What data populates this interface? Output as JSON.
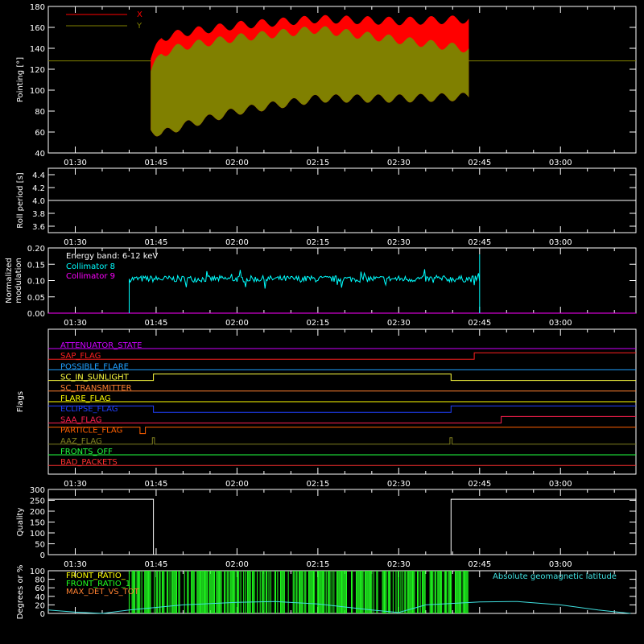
{
  "chart_data": [
    {
      "type": "line",
      "ylabel": "Pointing [°]",
      "ylim": [
        40,
        180
      ],
      "yticks": [
        40,
        60,
        80,
        100,
        120,
        140,
        160,
        180
      ],
      "xticks": [
        "01:30",
        "01:45",
        "02:00",
        "02:15",
        "02:30",
        "02:45",
        "03:00"
      ],
      "xlim_minutes": [
        85,
        194
      ],
      "legend": [
        {
          "name": "X",
          "color": "#ff0000"
        },
        {
          "name": "Y",
          "color": "#808000"
        }
      ],
      "baseline_value": 128,
      "active_start": "01:44",
      "active_end": "02:43",
      "series": [
        {
          "name": "X",
          "color": "#ff0000",
          "upper_envelope": [
            [
              104,
              130
            ],
            [
              106,
              150
            ],
            [
              110,
              155
            ],
            [
              120,
              162
            ],
            [
              135,
              168
            ],
            [
              150,
              166
            ],
            [
              165,
              168
            ],
            [
              180,
              164
            ],
            [
              193,
              162
            ]
          ],
          "lower_envelope": [
            [
              104,
              62
            ],
            [
              106,
              58
            ],
            [
              110,
              66
            ],
            [
              120,
              80
            ],
            [
              135,
              92
            ],
            [
              150,
              92
            ],
            [
              165,
              94
            ],
            [
              180,
              90
            ],
            [
              193,
              86
            ]
          ]
        },
        {
          "name": "Y",
          "color": "#808000",
          "upper_envelope": [
            [
              104,
              118
            ],
            [
              106,
              135
            ],
            [
              110,
              142
            ],
            [
              120,
              150
            ],
            [
              135,
              158
            ],
            [
              150,
              148
            ],
            [
              165,
              138
            ],
            [
              180,
              135
            ],
            [
              193,
              130
            ]
          ],
          "lower_envelope": [
            [
              104,
              62
            ],
            [
              106,
              58
            ],
            [
              110,
              66
            ],
            [
              120,
              80
            ],
            [
              135,
              92
            ],
            [
              150,
              92
            ],
            [
              165,
              94
            ],
            [
              180,
              90
            ],
            [
              193,
              86
            ]
          ]
        }
      ]
    },
    {
      "type": "line",
      "ylabel": "Roll period [s]",
      "ylim": [
        3.5,
        4.5
      ],
      "yticks": [
        3.6,
        3.8,
        4.0,
        4.2,
        4.4
      ],
      "ytick_labels": [
        "3.6",
        "3.8",
        "4.0",
        "4.2",
        "4.4"
      ],
      "xticks": [
        "01:30",
        "01:45",
        "02:00",
        "02:15",
        "02:30",
        "02:45",
        "03:00"
      ],
      "series": [
        {
          "name": "",
          "color": "#ffffff",
          "value": 4.0
        }
      ]
    },
    {
      "type": "line",
      "ylabel": "Normalized modulation",
      "ylim": [
        0,
        0.2
      ],
      "yticks": [
        0,
        0.05,
        0.1,
        0.15,
        0.2
      ],
      "ytick_labels": [
        "0.00",
        "0.05",
        "0.10",
        "0.15",
        "0.20"
      ],
      "xticks": [
        "01:30",
        "01:45",
        "02:00",
        "02:15",
        "02:30",
        "02:45",
        "03:00"
      ],
      "annotation": "Energy band: 6-12 keV",
      "legend": [
        {
          "name": "Collimator 8",
          "color": "#00ffff"
        },
        {
          "name": "Collimator 9",
          "color": "#ff00ff"
        }
      ],
      "series": [
        {
          "name": "Collimator 8",
          "color": "#00ffff",
          "start": "01:40",
          "end": "02:45",
          "mean": 0.105,
          "spread": 0.01
        },
        {
          "name": "Collimator 9",
          "color": "#ff00ff",
          "value": 0.0
        }
      ]
    },
    {
      "type": "line",
      "ylabel": "Flags",
      "xticks": [
        "01:30",
        "01:45",
        "02:00",
        "02:15",
        "02:30",
        "02:45",
        "03:00"
      ],
      "flags": [
        {
          "name": "ATTENUATOR_STATE",
          "color": "#cc00ff",
          "segments": [
            [
              85,
              194,
              0
            ]
          ]
        },
        {
          "name": "SAP_FLAG",
          "color": "#ff2020",
          "segments": [
            [
              85,
              164,
              0
            ],
            [
              164,
              194,
              1
            ]
          ]
        },
        {
          "name": "POSSIBLE_FLARE",
          "color": "#20a0ff",
          "segments": [
            [
              85,
              194,
              0
            ]
          ]
        },
        {
          "name": "SC_IN_SUNLIGHT",
          "color": "#ffff40",
          "segments": [
            [
              85,
              104.5,
              0
            ],
            [
              104.5,
              159.7,
              1
            ],
            [
              159.7,
              194,
              0
            ]
          ]
        },
        {
          "name": "SC_TRANSMITTER",
          "color": "#ff8030",
          "segments": [
            [
              85,
              194,
              0
            ]
          ]
        },
        {
          "name": "FLARE_FLAG",
          "color": "#ffff00",
          "segments": [
            [
              85,
              194,
              0
            ]
          ]
        },
        {
          "name": "ECLIPSE_FLAG",
          "color": "#2040ff",
          "segments": [
            [
              85,
              104.5,
              1
            ],
            [
              104.5,
              159.7,
              0
            ],
            [
              159.7,
              194,
              1
            ]
          ]
        },
        {
          "name": "SAA_FLAG",
          "color": "#ff2050",
          "segments": [
            [
              85,
              169,
              0
            ],
            [
              169,
              194,
              1
            ]
          ]
        },
        {
          "name": "PARTICLE_FLAG",
          "color": "#ff6000",
          "segments": [
            [
              85,
              102,
              1
            ],
            [
              102,
              103,
              0
            ],
            [
              103,
              194,
              1
            ]
          ]
        },
        {
          "name": "AAZ_FLAG",
          "color": "#808020",
          "segments": [
            [
              85,
              104.3,
              0
            ],
            [
              104.3,
              104.7,
              1
            ],
            [
              104.7,
              159.5,
              0
            ],
            [
              159.5,
              159.9,
              1
            ],
            [
              159.9,
              194,
              0
            ]
          ]
        },
        {
          "name": "FRONTS_OFF",
          "color": "#20ff40",
          "segments": [
            [
              85,
              194,
              0
            ]
          ]
        },
        {
          "name": "BAD_PACKETS",
          "color": "#ff3030",
          "segments": [
            [
              85,
              194,
              0
            ]
          ]
        }
      ]
    },
    {
      "type": "line",
      "ylabel": "Quality",
      "ylim": [
        0,
        300
      ],
      "yticks": [
        0,
        50,
        100,
        150,
        200,
        250,
        300
      ],
      "xticks": [
        "01:30",
        "01:45",
        "02:00",
        "02:15",
        "02:30",
        "02:45",
        "03:00"
      ],
      "series": [
        {
          "name": "",
          "color": "#ffffff",
          "segments": [
            [
              85,
              104.5,
              255
            ],
            [
              104.5,
              159.7,
              0
            ],
            [
              159.7,
              194,
              255
            ]
          ]
        }
      ]
    },
    {
      "type": "line",
      "ylabel": "Degrees or %",
      "ylim": [
        0,
        100
      ],
      "yticks": [
        0,
        20,
        40,
        60,
        80,
        100
      ],
      "legend": [
        {
          "name": "FRONT_RATIO_",
          "color": "#ffff00"
        },
        {
          "name": "FRONT_RATIO_1",
          "color": "#20ff20"
        },
        {
          "name": "MAX_DET_VS_TOT",
          "color": "#ff8030"
        },
        {
          "name": "Absolute geomagnetic latitude",
          "color": "#40e0e0"
        }
      ],
      "series": [
        {
          "name": "FRONT_RATIO_1",
          "color": "#20ff20",
          "start": "01:40",
          "end": "02:43"
        },
        {
          "name": "Absolute geomagnetic latitude",
          "color": "#40e0e0",
          "points": [
            [
              85,
              8
            ],
            [
              90,
              3
            ],
            [
              95,
              0
            ],
            [
              100,
              8
            ],
            [
              110,
              20
            ],
            [
              120,
              26
            ],
            [
              127,
              28
            ],
            [
              135,
              22
            ],
            [
              145,
              8
            ],
            [
              150,
              2
            ],
            [
              155,
              20
            ],
            [
              165,
              27
            ],
            [
              172,
              28
            ],
            [
              180,
              20
            ],
            [
              187,
              8
            ],
            [
              193,
              0
            ]
          ]
        }
      ]
    }
  ]
}
